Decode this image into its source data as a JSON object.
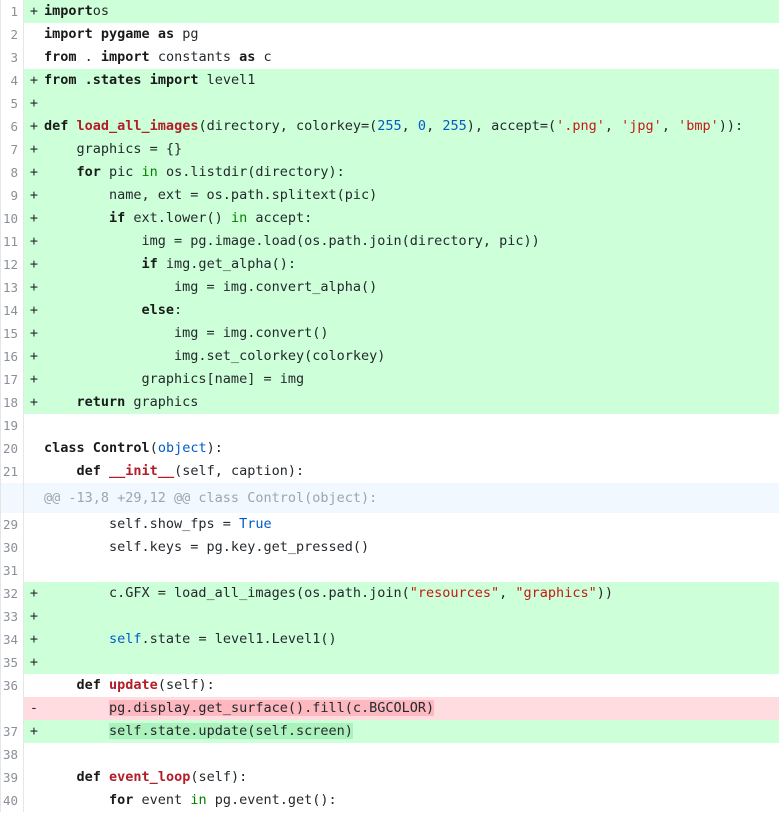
{
  "lines": [
    {
      "type": "add",
      "num": "1",
      "sign": "+",
      "tokens": [
        [
          "kw",
          "import"
        ],
        [
          "",
          "os"
        ]
      ]
    },
    {
      "type": "ctx",
      "num": "2",
      "sign": "",
      "tokens": [
        [
          "kw",
          "import"
        ],
        [
          "kw",
          " pygame"
        ],
        [
          "",
          ""
        ],
        [
          "kw",
          " as"
        ],
        [
          "",
          " pg"
        ]
      ]
    },
    {
      "type": "ctx",
      "num": "3",
      "sign": "",
      "tokens": [
        [
          "kw",
          "from"
        ],
        [
          "",
          " . "
        ],
        [
          "kw",
          "import"
        ],
        [
          "",
          " constants "
        ],
        [
          "kw",
          "as"
        ],
        [
          "",
          " c"
        ]
      ]
    },
    {
      "type": "add",
      "num": "4",
      "sign": "+",
      "tokens": [
        [
          "kw",
          "from"
        ],
        [
          "kw",
          " .states"
        ],
        [
          "",
          " "
        ],
        [
          "kw",
          "import"
        ],
        [
          "",
          " level1"
        ]
      ]
    },
    {
      "type": "add",
      "num": "5",
      "sign": "+",
      "tokens": []
    },
    {
      "type": "add",
      "num": "6",
      "sign": "+",
      "tokens": [
        [
          "kw",
          "def"
        ],
        [
          "",
          " "
        ],
        [
          "fn",
          "load_all_images"
        ],
        [
          "",
          "(directory, colorkey=("
        ],
        [
          "num",
          "255"
        ],
        [
          "",
          ", "
        ],
        [
          "num",
          "0"
        ],
        [
          "",
          ", "
        ],
        [
          "num",
          "255"
        ],
        [
          "",
          "), accept=("
        ],
        [
          "str",
          "'.png'"
        ],
        [
          "",
          ", "
        ],
        [
          "str",
          "'jpg'"
        ],
        [
          "",
          ", "
        ],
        [
          "str",
          "'bmp'"
        ],
        [
          "",
          ")):"
        ]
      ]
    },
    {
      "type": "add",
      "num": "7",
      "sign": "+",
      "tokens": [
        [
          "",
          "    graphics = {}"
        ]
      ]
    },
    {
      "type": "add",
      "num": "8",
      "sign": "+",
      "tokens": [
        [
          "kw",
          "    for"
        ],
        [
          "",
          " pic "
        ],
        [
          "op",
          "in"
        ],
        [
          "",
          " os.listdir(directory):"
        ]
      ]
    },
    {
      "type": "add",
      "num": "9",
      "sign": "+",
      "tokens": [
        [
          "",
          "        name, ext = os.path.splitext(pic)"
        ]
      ]
    },
    {
      "type": "add",
      "num": "10",
      "sign": "+",
      "tokens": [
        [
          "kw",
          "        if"
        ],
        [
          "",
          " ext.lower() "
        ],
        [
          "op",
          "in"
        ],
        [
          "",
          " accept:"
        ]
      ]
    },
    {
      "type": "add",
      "num": "11",
      "sign": "+",
      "tokens": [
        [
          "",
          "            img = pg.image.load(os.path.join(directory, pic))"
        ]
      ]
    },
    {
      "type": "add",
      "num": "12",
      "sign": "+",
      "tokens": [
        [
          "kw",
          "            if"
        ],
        [
          "",
          " img.get_alpha():"
        ]
      ]
    },
    {
      "type": "add",
      "num": "13",
      "sign": "+",
      "tokens": [
        [
          "",
          "                img = img.convert_alpha()"
        ]
      ]
    },
    {
      "type": "add",
      "num": "14",
      "sign": "+",
      "tokens": [
        [
          "kw",
          "            else"
        ],
        [
          "",
          ":"
        ]
      ]
    },
    {
      "type": "add",
      "num": "15",
      "sign": "+",
      "tokens": [
        [
          "",
          "                img = img.convert()"
        ]
      ]
    },
    {
      "type": "add",
      "num": "16",
      "sign": "+",
      "tokens": [
        [
          "",
          "                img.set_colorkey(colorkey)"
        ]
      ]
    },
    {
      "type": "add",
      "num": "17",
      "sign": "+",
      "tokens": [
        [
          "",
          "            graphics[name] = img"
        ]
      ]
    },
    {
      "type": "add",
      "num": "18",
      "sign": "+",
      "tokens": [
        [
          "kw",
          "    return"
        ],
        [
          "",
          " graphics"
        ]
      ]
    },
    {
      "type": "ctx",
      "num": "19",
      "sign": "",
      "tokens": []
    },
    {
      "type": "ctx",
      "num": "20",
      "sign": "",
      "tokens": [
        [
          "kw",
          "class"
        ],
        [
          "",
          " "
        ],
        [
          "kw",
          "Control"
        ],
        [
          "",
          "("
        ],
        [
          "blt",
          "object"
        ],
        [
          "",
          "):"
        ]
      ]
    },
    {
      "type": "ctx",
      "num": "21",
      "sign": "",
      "tokens": [
        [
          "kw",
          "    def"
        ],
        [
          "",
          " "
        ],
        [
          "fn",
          "__init__"
        ],
        [
          "",
          "(self, caption):"
        ]
      ]
    },
    {
      "type": "hunk",
      "num": "",
      "sign": "",
      "tokens": [
        [
          "",
          "@@ -13,8 +29,12 @@ class Control(object):"
        ]
      ]
    },
    {
      "type": "ctx",
      "num": "29",
      "sign": "",
      "tokens": [
        [
          "",
          "        self.show_fps = "
        ],
        [
          "blt",
          "True"
        ]
      ]
    },
    {
      "type": "ctx",
      "num": "30",
      "sign": "",
      "tokens": [
        [
          "",
          "        self.keys = pg.key.get_pressed()"
        ]
      ]
    },
    {
      "type": "ctx",
      "num": "31",
      "sign": "",
      "tokens": []
    },
    {
      "type": "add",
      "num": "32",
      "sign": "+",
      "tokens": [
        [
          "",
          "        c.GFX = load_all_images(os.path.join("
        ],
        [
          "str",
          "\"resources\""
        ],
        [
          "",
          ", "
        ],
        [
          "str",
          "\"graphics\""
        ],
        [
          "",
          "))"
        ]
      ]
    },
    {
      "type": "add",
      "num": "33",
      "sign": "+",
      "tokens": []
    },
    {
      "type": "add",
      "num": "34",
      "sign": "+",
      "tokens": [
        [
          "",
          "        "
        ],
        [
          "blt",
          "self"
        ],
        [
          "",
          ".state = level1.Level1()"
        ]
      ]
    },
    {
      "type": "add",
      "num": "35",
      "sign": "+",
      "tokens": []
    },
    {
      "type": "ctx",
      "num": "36",
      "sign": "",
      "tokens": [
        [
          "kw",
          "    def"
        ],
        [
          "",
          " "
        ],
        [
          "fn",
          "update"
        ],
        [
          "",
          "(self):"
        ]
      ]
    },
    {
      "type": "del",
      "num": "",
      "sign": "-",
      "tokens": [
        [
          "",
          "        "
        ],
        [
          "hl-del",
          "pg.display.get_surface().fill(c.BGCOLOR)"
        ]
      ]
    },
    {
      "type": "add",
      "num": "37",
      "sign": "+",
      "tokens": [
        [
          "",
          "        "
        ],
        [
          "hl-add",
          "self.state.update(self.screen)"
        ]
      ]
    },
    {
      "type": "ctx",
      "num": "38",
      "sign": "",
      "tokens": []
    },
    {
      "type": "ctx",
      "num": "39",
      "sign": "",
      "tokens": [
        [
          "kw",
          "    def"
        ],
        [
          "",
          " "
        ],
        [
          "fn",
          "event_loop"
        ],
        [
          "",
          "(self):"
        ]
      ]
    },
    {
      "type": "ctx",
      "num": "40",
      "sign": "",
      "tokens": [
        [
          "kw",
          "        for"
        ],
        [
          "",
          " event "
        ],
        [
          "op",
          "in"
        ],
        [
          "",
          " pg.event.get():"
        ]
      ]
    }
  ]
}
